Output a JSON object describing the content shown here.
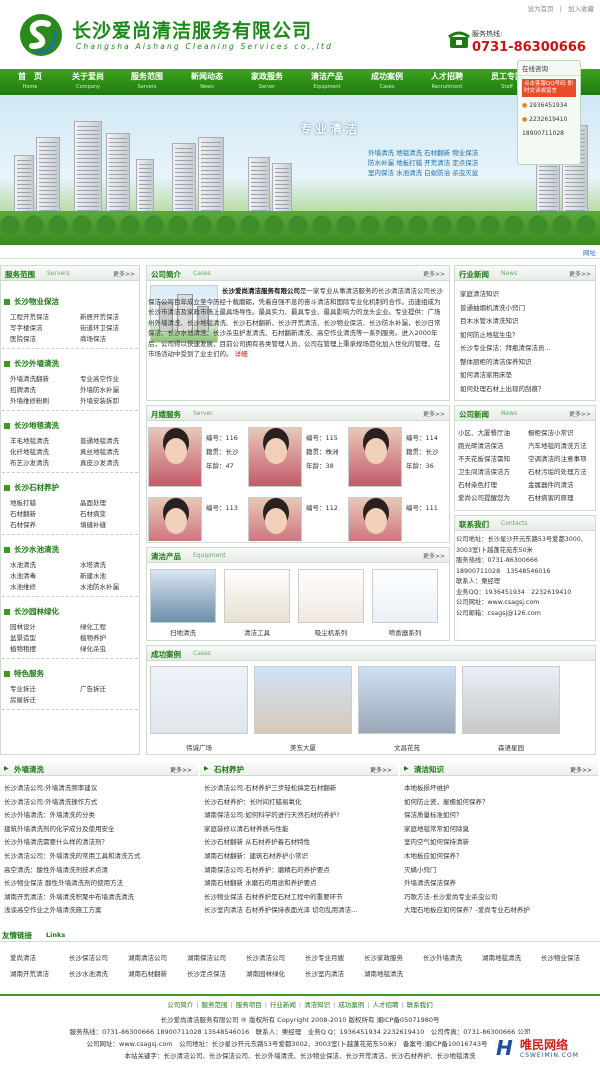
{
  "header": {
    "top_links": [
      "设为首页",
      "加入收藏"
    ],
    "company_name": "长沙爱尚清洁服务有限公司",
    "company_en": "Changsha Aishang Cleaning Services co.,ltd",
    "hotline_label": "服务热线:",
    "hotline": "0731-86300666"
  },
  "nav": [
    {
      "cn": "首　页",
      "en": "Home"
    },
    {
      "cn": "关于爱尚",
      "en": "Company"
    },
    {
      "cn": "服务范围",
      "en": "Servers"
    },
    {
      "cn": "新闻动态",
      "en": "News"
    },
    {
      "cn": "家政服务",
      "en": "Server"
    },
    {
      "cn": "清洁产品",
      "en": "Equipment"
    },
    {
      "cn": "成功案例",
      "en": "Cases"
    },
    {
      "cn": "人才招聘",
      "en": "Recruitment"
    },
    {
      "cn": "员工专区",
      "en": "Staff"
    }
  ],
  "chat": {
    "title": "在线咨询",
    "banner": "点击客服QQ号码 即时交谈或留言",
    "numbers": [
      "1936451934",
      "2232619410",
      "18900711028"
    ]
  },
  "banner": {
    "title": "专业清洁",
    "keywords": [
      "外墙清洗",
      "地毯清洗",
      "石材翻新",
      "物业保洁",
      "防水补漏",
      "地板打蜡",
      "开荒清洁",
      "定点保洁",
      "室内保洁",
      "水池清洗",
      "白蚁防治",
      "杀虫灭鼠"
    ],
    "link": "网址"
  },
  "more": "更多>>",
  "left": {
    "title": "服务范围",
    "title_en": "Servers",
    "sections": [
      {
        "name": "长沙物业保洁",
        "items": [
          "工程开荒保洁",
          "新居开荒保洁",
          "写字楼保洁",
          "街道环卫保洁",
          "医院保洁",
          "商场保洁"
        ]
      },
      {
        "name": "长沙外墙清洗",
        "items": [
          "外墙清洗翻新",
          "专业高空作业",
          "招牌清洗",
          "外墙防水补漏",
          "外墙维修粉刷",
          "外墙安装拆卸"
        ]
      },
      {
        "name": "长沙地毯清洗",
        "items": [
          "羊毛地毯清洗",
          "普通地毯清洗",
          "化纤地毯清洗",
          "真丝地毯清洗",
          "布艺沙发清洗",
          "真皮沙发清洗"
        ]
      },
      {
        "name": "长沙石材养护",
        "items": [
          "地板打蜡",
          "晶面处理",
          "石材翻新",
          "石材病变",
          "石材保养",
          "填缝补缝"
        ]
      },
      {
        "name": "长沙水池清洗",
        "items": [
          "水池清洗",
          "水塔清洗",
          "水池清毒",
          "新建水池",
          "水池维修",
          "水池防水补漏"
        ]
      },
      {
        "name": "长沙园林绿化",
        "items": [
          "园林设计",
          "绿化工程",
          "盆景造型",
          "植物养护",
          "植物租摆",
          "绿化杀虫"
        ]
      },
      {
        "name": "特色服务",
        "items": [
          "专业拆迁",
          "广告拆迁",
          "房屋拆迁"
        ]
      }
    ]
  },
  "intro": {
    "title": "公司简介",
    "title_en": "Cases",
    "bold": "长沙爱尚清洁服务有限公司",
    "text": "是一家专业从事清洁服务的长沙清洁清洁公司长沙保洁公司目年成立至今历经十载磨砺，凭着自强不息的奋斗清洁和国际专业化机制的合作。迅速组成为长沙市清洁及家政市场上最具场导性。最具实力、最具专业、最具影响力的龙头企业。专业提供：广场州外墙清洗、长沙地毯清洗、长沙石材翻新、长沙开荒清洁、长沙物业保洁、长沙防水补漏，长沙日常保洁、长沙水池清洗、长沙杀虫护发清洗、石材翻新清洗、高空作业清洗等一系列服务。进入2000年后，公司得以快速发展，目前公司拥有各类管理人员，公司在管理上秉承规场范化加入世化的管理，在市场活动中受到了业主们的。",
    "detail": "详细"
  },
  "staff": {
    "title": "月嫂服务",
    "title_en": "Server",
    "labels": {
      "id": "编号：",
      "origin": "籍贯：",
      "age": "年龄："
    },
    "people": [
      {
        "id": "116",
        "origin": "长沙",
        "age": "47"
      },
      {
        "id": "115",
        "origin": "株洲",
        "age": "38"
      },
      {
        "id": "114",
        "origin": "长沙",
        "age": "36"
      },
      {
        "id": "113",
        "origin": "",
        "age": ""
      },
      {
        "id": "112",
        "origin": "",
        "age": ""
      },
      {
        "id": "111",
        "origin": "",
        "age": ""
      }
    ]
  },
  "equipment": {
    "title": "清洁产品",
    "title_en": "Equipment",
    "items": [
      "扫地清洗",
      "清洁工具",
      "吸尘机系列",
      "喷香器系列"
    ]
  },
  "cases": {
    "title": "成功案例",
    "title_en": "Cases",
    "items": [
      "伟诚广场",
      "美东大厦",
      "文昌花苑",
      "森语星园"
    ]
  },
  "news": {
    "title": "行业新闻",
    "title_en": "News",
    "items": [
      "家庭清洁知识",
      "普通抽烟机清洗小窍门",
      "目木水管水清洗知识",
      "如何防止地毯生虫？",
      "长沙专业保洁：拜瓶清保洁员...",
      "整体厨柜的清洁保养知识",
      "如何清洁家用床垫",
      "如何处理石材上出现的刮痕？"
    ]
  },
  "company_news": {
    "title": "公司新闻",
    "title_en": "News",
    "items": [
      "小区、大厦餐厅油",
      "橱柜保洁小常识",
      "跑光砖清洁保洁",
      "汽车地毯的清洗方法",
      "不天花板保洁需知",
      "空调清洁的注意事项",
      "卫生间清洁保洁方",
      "石材污垢的处理方法",
      "石材染色打理",
      "金属器件的清洁",
      "爱尚公司提醒您为",
      "石材病害的原理"
    ]
  },
  "contact": {
    "title": "联系我们",
    "title_en": "Contacts",
    "lines": [
      "公司地址：长沙星沙开元东路53号爱都3000、3003室(卜越蓬花苑东50米",
      "服务热线：0731-86300666",
      "18900711028　13548546016",
      "联系人：栗经理",
      "业务QQ：1936451934　2232619410",
      "公司网址：www.csagsj.com",
      "公司邮箱：csagsj@126.com"
    ]
  },
  "bottom_cols": [
    {
      "title": "外墙清洗",
      "items": [
        "长沙清洁公司:外墙清洗频率建议",
        "长沙清洁公司:外墙清洗操作方式",
        "长沙外墙清洗：外墙清洗的分类",
        "建筑外墙清洗剂的化学成分及使用安全",
        "长沙外墙清洗需要什么样的清洁剂？",
        "长沙清洁公司：外墙清洗的常用工具和清洗方式",
        "高空清洗：酸性外墙清洗剂技术点清",
        "长沙物业保洁 酸性外墙清洗剂的使用方法",
        "湖南开荒清洁：外墙清洗积聚中布墙清洗清洗",
        "浅谈高空作业之外墙清洗施工方案"
      ]
    },
    {
      "title": "石材养护",
      "items": [
        "长沙清洁公司:石材养护三步轻松搞定石材翻新",
        "长沙石材养护：长时间打蜡易氧化",
        "湖南保洁公司:如何科学的进行天然石材的养护?",
        "家庭装修以清石材养质与性能",
        "长沙石材翻新 从石材养护着石材特性",
        "湖南石材翻新：建筑石材养护小常识",
        "湖南保洁公司:石材养护：磨精石的养护要点",
        "湖南石材翻新 水磨石的用途和养护要点",
        "长沙物业保洁 石材养护是石材工程中的重要环节",
        "长沙室内清洁 石材养护保持表面光泽 切勿乱用清洁..."
      ]
    },
    {
      "title": "清洁知识",
      "items": [
        "本地板损坏维护",
        "如何防止瓷，屋檐如何保养？",
        "保洁质量标准如何？",
        "家庭地毯常常如何除臭",
        "室内空气如何保持清新",
        "木地板应如何保养？",
        "灭螨小窍门",
        "外墙清洗保洁保养",
        "巧歌方法-长沙爱尚专业杀虫公司",
        "大理石地板应如何保养？-爱尚专业石材养护"
      ]
    }
  ],
  "friend_links": {
    "title": "友情链接",
    "title_en": "Links",
    "items": [
      "爱尚清洁",
      "长沙保洁公司",
      "湖南清洁公司",
      "湖南保洁公司",
      "长沙清洁公司",
      "长沙专业月嫂",
      "长沙家政服务",
      "长沙外墙清洗",
      "湖南地毯清洗",
      "长沙物业保洁",
      "湖南开荒清洁",
      "长沙水池清洗",
      "湖南石材翻新",
      "长沙定点保洁",
      "湖南园林绿化",
      "长沙室内清洁",
      "湖南地毯清洗"
    ]
  },
  "footer": {
    "links": [
      "公司简介",
      "服务范围",
      "服务项目",
      "行业新闻",
      "清洁知识",
      "成功案例",
      "人才招聘",
      "联系我们"
    ],
    "line1": "长沙爱尚清洁服务有限公司 ® 版权所有 Copyright 2008-2010 版权所有 湘ICP备05071980号",
    "line2": "服务热线：0731-86300666 18900711028 13548546016　联系人：栗经理　业务Q Q：1936451934 2232619410　公司传真：0731-86300666 公司",
    "line3": "公司网址：www.csagsj.com　公司地址：长沙星沙开元东路53号爱都3002、3003室(卜越蓬花苑东50米)　备案号:湘ICP备10016743号　技术支",
    "line4": "本站关键字：长沙清洁公司、长沙保洁公司、长沙外墙清洗、长沙物业保洁、长沙开荒清洁、长沙石材养护、长沙地毯清洗",
    "watermark": "唯民网络",
    "watermark_url": "CSWEIMIN.COM"
  }
}
